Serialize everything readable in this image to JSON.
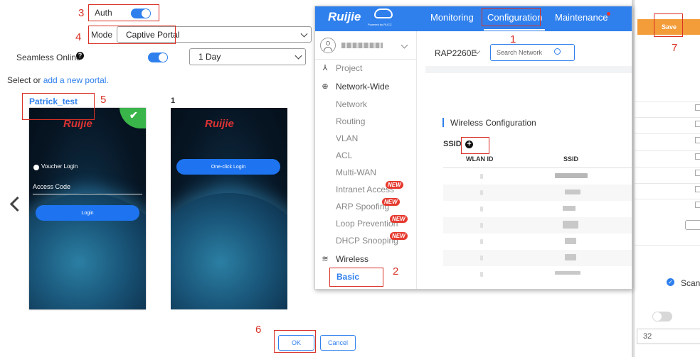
{
  "form": {
    "auth_label": "Auth",
    "mode_label": "Mode",
    "mode_value": "Captive Portal",
    "seamless_label": "Seamless Online",
    "seamless_value": "1 Day",
    "select_text": "Select or",
    "add_portal_link": "add a new portal."
  },
  "portals": [
    {
      "name": "Patrick_test",
      "logo": "Ruijie",
      "login_type": "Voucher Login",
      "field_label": "Access Code",
      "button": "Login"
    },
    {
      "name": "1",
      "logo": "Ruijie",
      "button": "One-click Login"
    }
  ],
  "footer": {
    "ok": "OK",
    "cancel": "Cancel"
  },
  "nav": {
    "brand": "Ruijie",
    "brand_sub": "Powered by RUCC",
    "items": [
      "Monitoring",
      "Configuration",
      "Maintenance"
    ]
  },
  "device": {
    "model": "RAP2260E",
    "search_placeholder": "Search Network"
  },
  "sidebar": {
    "project": "Project",
    "network_wide": "Network-Wide",
    "items": [
      "Network",
      "Routing",
      "VLAN",
      "ACL",
      "Multi-WAN",
      "Intranet Access",
      "ARP Spoofing",
      "Loop Prevention",
      "DHCP Snooping"
    ],
    "new_badge": "NEW",
    "wireless": "Wireless",
    "basic": "Basic"
  },
  "wireless": {
    "section_title": "Wireless Configuration",
    "ssid_label": "SSID",
    "columns": [
      "WLAN ID",
      "SSID"
    ]
  },
  "right_panel": {
    "save": "Save",
    "scan": "Scan",
    "number_value": "32"
  },
  "annotations": [
    "1",
    "2",
    "3",
    "4",
    "5",
    "6",
    "7"
  ],
  "colors": {
    "accent": "#2f80ed",
    "annotation": "#d93025",
    "save": "#f39c3a",
    "new_badge": "#e63a2f"
  }
}
